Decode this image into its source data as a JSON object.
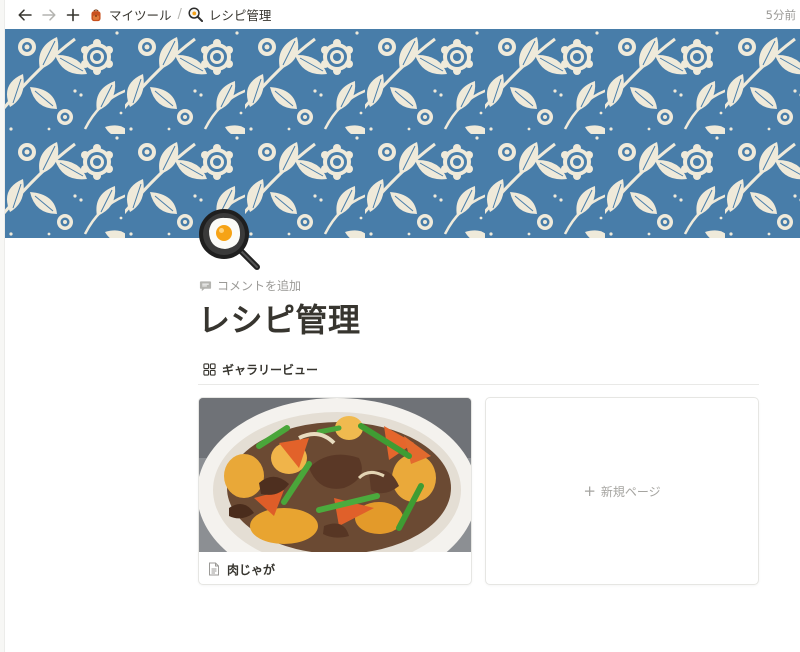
{
  "topbar": {
    "breadcrumbs": [
      {
        "icon": "backpack-icon",
        "label": "マイツール"
      },
      {
        "icon": "cooking-icon",
        "label": "レシピ管理"
      }
    ],
    "separator": "/",
    "edited": "5分前"
  },
  "page": {
    "title": "レシピ管理",
    "icon": "cooking-icon",
    "add_comment_label": "コメントを追加"
  },
  "view": {
    "label": "ギャラリービュー",
    "icon": "gallery-grid-icon"
  },
  "gallery": {
    "cards": [
      {
        "title": "肉じゃが",
        "icon": "page-doc-icon",
        "image": "nikujaga-photo"
      }
    ],
    "new_page": {
      "plus": "+",
      "label": "新規ページ"
    }
  },
  "colors": {
    "text": "#37352f",
    "muted": "#9b9a97",
    "cover_blue": "#3f76a5",
    "cover_cream": "#efe9d8",
    "divider": "#e9e9e7"
  }
}
